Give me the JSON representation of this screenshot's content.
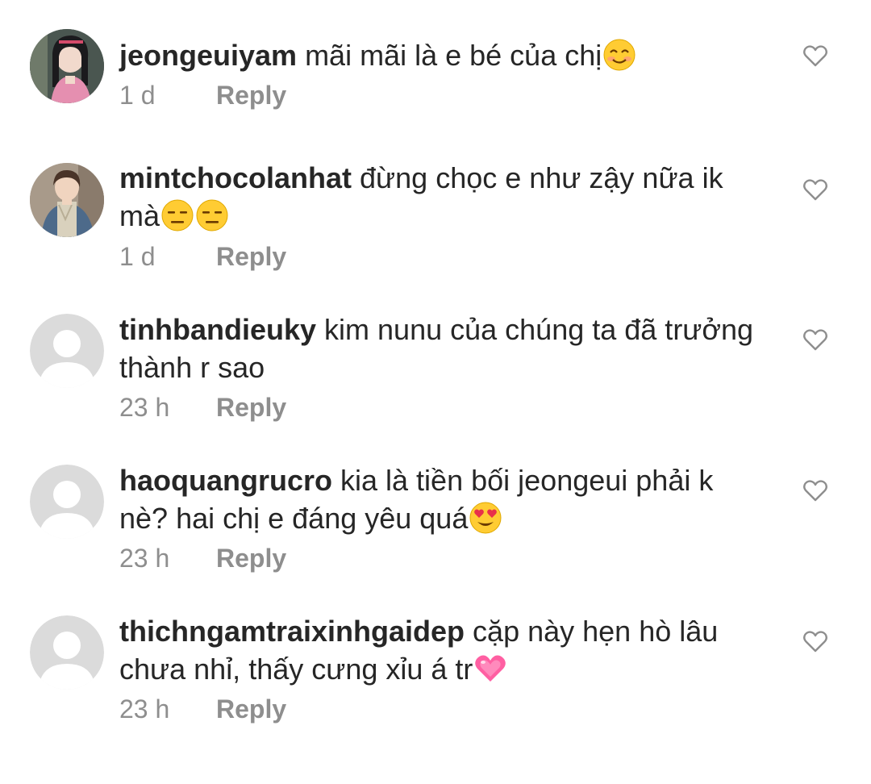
{
  "comments": [
    {
      "username": "jeongeuiyam",
      "text": "mãi mãi là e bé của chị",
      "emoji": [
        "smiling-blush-emoji"
      ],
      "time": "1 d",
      "reply_label": "Reply",
      "avatar": "photo-avatar"
    },
    {
      "username": "mintchocolanhat",
      "text": "đừng chọc e như zậy nữa ik mà",
      "emoji": [
        "expressionless-face-emoji",
        "expressionless-face-emoji"
      ],
      "time": "1 d",
      "reply_label": "Reply",
      "avatar": "photo-avatar"
    },
    {
      "username": "tinhbandieuky",
      "text": "kim nunu của chúng ta đã trưởng thành r sao",
      "emoji": [],
      "time": "23 h",
      "reply_label": "Reply",
      "avatar": "default-avatar"
    },
    {
      "username": "haoquangrucro",
      "text": "kia là tiền bối jeongeui phải k nè? hai chị e đáng yêu quá",
      "emoji": [
        "heart-eyes-emoji"
      ],
      "time": "23 h",
      "reply_label": "Reply",
      "avatar": "default-avatar"
    },
    {
      "username": "thichngamtraixinhgaidep",
      "text": "cặp này hẹn hò lâu chưa nhỉ, thấy cưng xỉu á tr",
      "emoji": [
        "pink-heart-emoji"
      ],
      "time": "23 h",
      "reply_label": "Reply",
      "avatar": "default-avatar"
    }
  ],
  "colors": {
    "username": "#262626",
    "body_text": "#262626",
    "meta_text": "#8e8e8e",
    "default_avatar_bg": "#dbdbdb",
    "heart_outline": "#8e8e8e"
  },
  "icons": {
    "like": "heart-outline-icon",
    "default_avatar": "default-user-icon"
  }
}
